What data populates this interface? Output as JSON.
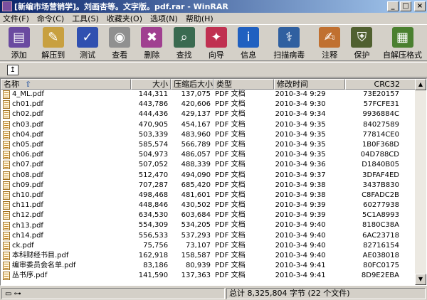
{
  "window": {
    "title": "[新编市场营销学]。刘画杏等。文字版。pdf.rar - WinRAR",
    "minimize": "_",
    "maximize": "□",
    "close": "×"
  },
  "menu": [
    "文件(F)",
    "命令(C)",
    "工具(S)",
    "收藏夹(O)",
    "选项(N)",
    "帮助(H)"
  ],
  "toolbar": [
    {
      "label": "添加",
      "icon": "add-books-icon",
      "glyph": "▤",
      "color": "#6a4aa0"
    },
    {
      "label": "解压到",
      "icon": "extract-to-icon",
      "glyph": "✎",
      "color": "#c8a040"
    },
    {
      "label": "测试",
      "icon": "test-icon",
      "glyph": "✓",
      "color": "#3050b0"
    },
    {
      "label": "查看",
      "icon": "view-icon",
      "glyph": "◉",
      "color": "#909090"
    },
    {
      "label": "删除",
      "icon": "delete-icon",
      "glyph": "✖",
      "color": "#a04090"
    },
    {
      "label": "查找",
      "icon": "find-icon",
      "glyph": "⌕",
      "color": "#3a6a50"
    },
    {
      "label": "向导",
      "icon": "wizard-icon",
      "glyph": "✦",
      "color": "#c03050"
    },
    {
      "label": "信息",
      "icon": "info-icon",
      "glyph": "i",
      "color": "#2060c0"
    },
    {
      "label": "扫描病毒",
      "icon": "virus-scan-icon",
      "glyph": "⚕",
      "color": "#3060a0"
    },
    {
      "label": "注释",
      "icon": "comment-icon",
      "glyph": "✍",
      "color": "#c07030"
    },
    {
      "label": "保护",
      "icon": "protect-shield-icon",
      "glyph": "⛨",
      "color": "#506030"
    },
    {
      "label": "自解压格式",
      "icon": "sfx-icon",
      "glyph": "▦",
      "color": "#4a8030"
    }
  ],
  "columns": {
    "name": "名称",
    "sort_indicator": "⇧",
    "size": "大小",
    "packed": "压缩后大小",
    "type": "类型",
    "modified": "修改时间",
    "crc": "CRC32"
  },
  "files": [
    {
      "name": "4_ML.pdf",
      "size": "144,311",
      "packed": "137,075",
      "type": "PDF 文档",
      "modified": "2010-3-4 9:29",
      "crc": "73E20157"
    },
    {
      "name": "ch01.pdf",
      "size": "443,786",
      "packed": "420,606",
      "type": "PDF 文档",
      "modified": "2010-3-4 9:30",
      "crc": "57FCFE31"
    },
    {
      "name": "ch02.pdf",
      "size": "444,436",
      "packed": "429,137",
      "type": "PDF 文档",
      "modified": "2010-3-4 9:34",
      "crc": "9936884C"
    },
    {
      "name": "ch03.pdf",
      "size": "470,905",
      "packed": "454,167",
      "type": "PDF 文档",
      "modified": "2010-3-4 9:35",
      "crc": "84027589"
    },
    {
      "name": "ch04.pdf",
      "size": "503,339",
      "packed": "483,960",
      "type": "PDF 文档",
      "modified": "2010-3-4 9:35",
      "crc": "77814CE0"
    },
    {
      "name": "ch05.pdf",
      "size": "585,574",
      "packed": "566,789",
      "type": "PDF 文档",
      "modified": "2010-3-4 9:35",
      "crc": "1B0F368D"
    },
    {
      "name": "ch06.pdf",
      "size": "504,973",
      "packed": "486,057",
      "type": "PDF 文档",
      "modified": "2010-3-4 9:35",
      "crc": "04D788CD"
    },
    {
      "name": "ch07.pdf",
      "size": "507,052",
      "packed": "488,339",
      "type": "PDF 文档",
      "modified": "2010-3-4 9:36",
      "crc": "D1840B05"
    },
    {
      "name": "ch08.pdf",
      "size": "512,470",
      "packed": "494,090",
      "type": "PDF 文档",
      "modified": "2010-3-4 9:37",
      "crc": "3DFAF4ED"
    },
    {
      "name": "ch09.pdf",
      "size": "707,287",
      "packed": "685,420",
      "type": "PDF 文档",
      "modified": "2010-3-4 9:38",
      "crc": "3437B830"
    },
    {
      "name": "ch10.pdf",
      "size": "498,468",
      "packed": "481,601",
      "type": "PDF 文档",
      "modified": "2010-3-4 9:38",
      "crc": "C8FADC2B"
    },
    {
      "name": "ch11.pdf",
      "size": "448,846",
      "packed": "430,502",
      "type": "PDF 文档",
      "modified": "2010-3-4 9:39",
      "crc": "60277938"
    },
    {
      "name": "ch12.pdf",
      "size": "634,530",
      "packed": "603,684",
      "type": "PDF 文档",
      "modified": "2010-3-4 9:39",
      "crc": "5C1A8993"
    },
    {
      "name": "ch13.pdf",
      "size": "554,309",
      "packed": "534,205",
      "type": "PDF 文档",
      "modified": "2010-3-4 9:40",
      "crc": "8180C38A"
    },
    {
      "name": "ch14.pdf",
      "size": "556,533",
      "packed": "537,293",
      "type": "PDF 文档",
      "modified": "2010-3-4 9:40",
      "crc": "6AC23718"
    },
    {
      "name": "ck.pdf",
      "size": "75,756",
      "packed": "73,107",
      "type": "PDF 文档",
      "modified": "2010-3-4 9:40",
      "crc": "82716154"
    },
    {
      "name": "本科财经书目.pdf",
      "size": "162,918",
      "packed": "158,587",
      "type": "PDF 文档",
      "modified": "2010-3-4 9:40",
      "crc": "AE038018"
    },
    {
      "name": "编审委员会名单.pdf",
      "size": "83,186",
      "packed": "80,939",
      "type": "PDF 文档",
      "modified": "2010-3-4 9:41",
      "crc": "80FC0175"
    },
    {
      "name": "丛书序.pdf",
      "size": "141,590",
      "packed": "137,363",
      "type": "PDF 文档",
      "modified": "2010-3-4 9:41",
      "crc": "8D9E2EBA"
    }
  ],
  "status": {
    "total": "总计 8,325,804 字节 (22 个文件)"
  }
}
